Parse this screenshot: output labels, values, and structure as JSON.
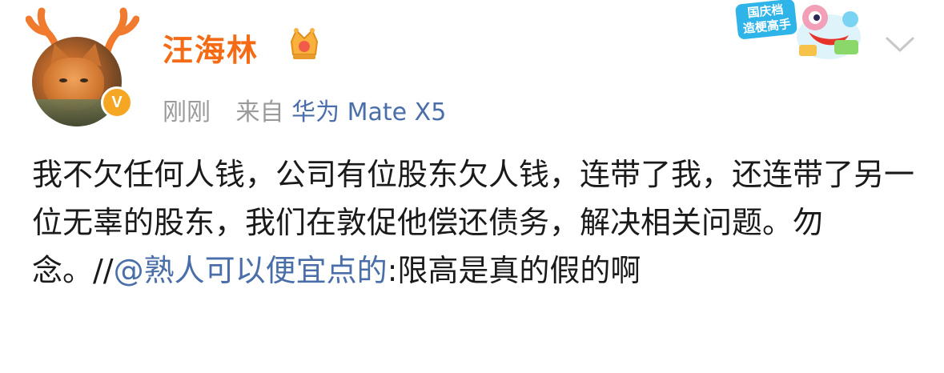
{
  "post": {
    "author": {
      "name": "汪海林",
      "verified_badge": "v-badge-icon",
      "avatar": "cat-avatar-with-antlers"
    },
    "time": "刚刚",
    "source_prefix": "来自",
    "source_device": "华为 Mate X5",
    "promo": {
      "line1": "国庆档",
      "line2": "造梗高手"
    },
    "body": {
      "main_text": "我不欠任何人钱，公司有位股东欠人钱，连带了我，还连带了另一位无辜的股东，我们在敦促他偿还债务，解决相关问题。勿念。//",
      "mention": "@熟人可以便宜点的",
      "quoted_text": ":限高是真的假的啊"
    }
  },
  "colors": {
    "username": "#f56b15",
    "link": "#4a6ea9",
    "meta": "#9a9a9a",
    "text": "#1a1a1a",
    "vip_badge": "#f5a623"
  }
}
